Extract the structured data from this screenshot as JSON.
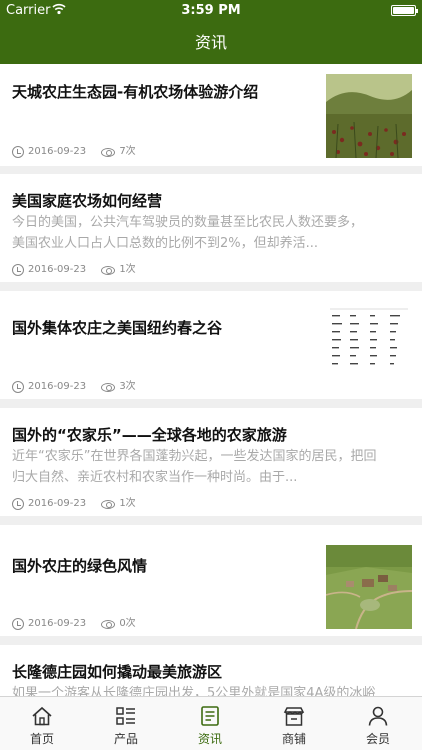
{
  "status_bar": {
    "carrier": "Carrier",
    "time": "3:59 PM"
  },
  "nav": {
    "title": "资讯"
  },
  "articles": [
    {
      "title": "天城农庄生态园-有机农场体验游介绍",
      "summary": "",
      "date": "2016-09-23",
      "views": "7次",
      "thumbnail": "landscape-farm-mountain"
    },
    {
      "title": "美国家庭农场如何经营",
      "summary_line1": "今日的美国，公共汽车驾驶员的数量甚至比农民人数还要多，",
      "summary_line2": "美国农业人口占人口总数的比例不到2%，但却养活...",
      "date": "2016-09-23",
      "views": "1次"
    },
    {
      "title": "国外集体农庄之美国纽约春之谷",
      "summary": "",
      "date": "2016-09-23",
      "views": "3次",
      "thumbnail": "text-table-scan"
    },
    {
      "title": "国外的“农家乐”——全球各地的农家旅游",
      "summary_line1": "近年“农家乐”在世界各国蓬勃兴起，一些发达国家的居民，把回",
      "summary_line2": "归大自然、亲近农村和农家当作一种时尚。由于...",
      "date": "2016-09-23",
      "views": "1次"
    },
    {
      "title": "国外农庄的绿色风情",
      "summary": "",
      "date": "2016-09-23",
      "views": "0次",
      "thumbnail": "aerial-farm"
    },
    {
      "title": "长隆德庄园如何撬动最美旅游区",
      "summary_line1": "如果一个游客从长隆德庄园出发，5公里外就是国家4A级的冰峪",
      "date": "",
      "views": ""
    }
  ],
  "tabs": [
    {
      "label": "首页",
      "icon": "home-icon",
      "active": false
    },
    {
      "label": "产品",
      "icon": "list-icon",
      "active": false
    },
    {
      "label": "资讯",
      "icon": "news-icon",
      "active": true
    },
    {
      "label": "商铺",
      "icon": "shop-icon",
      "active": false
    },
    {
      "label": "会员",
      "icon": "user-icon",
      "active": false
    }
  ],
  "colors": {
    "brand": "#3c6b10",
    "background": "#efefef",
    "summary_text": "#a9a9a9",
    "meta_text": "#888888"
  }
}
